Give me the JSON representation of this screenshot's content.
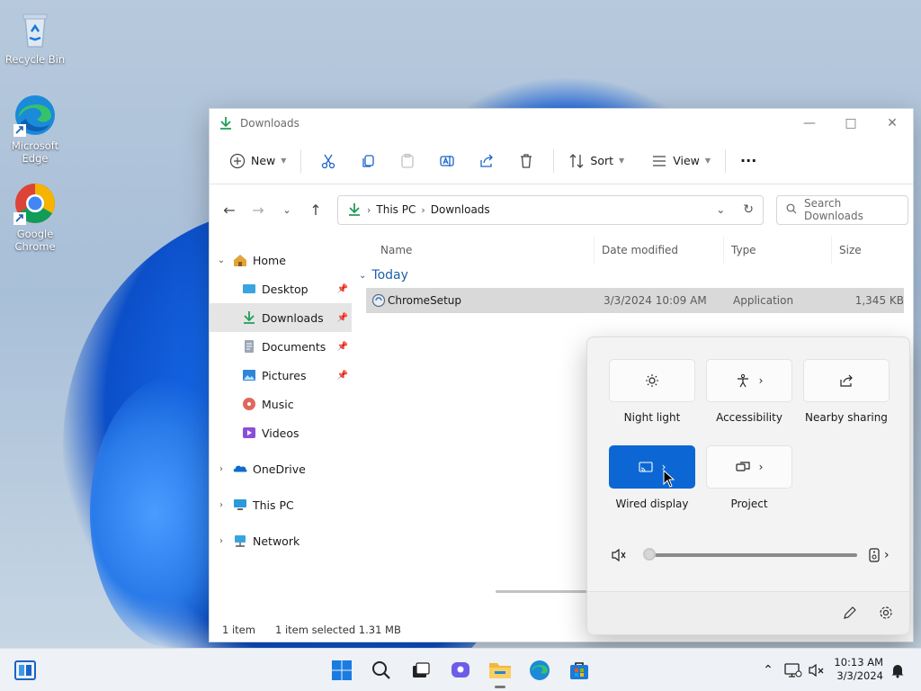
{
  "desktop": {
    "icons": [
      {
        "label": "Recycle Bin"
      },
      {
        "label": "Microsoft Edge"
      },
      {
        "label": "Google Chrome"
      }
    ]
  },
  "explorer": {
    "title": "Downloads",
    "toolbar": {
      "new_label": "New",
      "sort_label": "Sort",
      "view_label": "View",
      "more_label": "···"
    },
    "address": {
      "segments": [
        "This PC",
        "Downloads"
      ]
    },
    "search": {
      "placeholder": "Search Downloads"
    },
    "sidebar": {
      "items": [
        {
          "label": "Home"
        },
        {
          "label": "Desktop"
        },
        {
          "label": "Downloads"
        },
        {
          "label": "Documents"
        },
        {
          "label": "Pictures"
        },
        {
          "label": "Music"
        },
        {
          "label": "Videos"
        },
        {
          "label": "OneDrive"
        },
        {
          "label": "This PC"
        },
        {
          "label": "Network"
        }
      ]
    },
    "columns": [
      "Name",
      "Date modified",
      "Type",
      "Size"
    ],
    "group": "Today",
    "files": [
      {
        "name": "ChromeSetup",
        "date": "3/3/2024 10:09 AM",
        "type": "Application",
        "size": "1,345 KB"
      }
    ],
    "status": {
      "count": "1 item",
      "selection": "1 item selected  1.31 MB"
    }
  },
  "quick_settings": {
    "tiles": [
      {
        "label": "Night light",
        "active": false
      },
      {
        "label": "Accessibility",
        "active": false
      },
      {
        "label": "Nearby sharing",
        "active": false
      },
      {
        "label": "Wired display",
        "active": true
      },
      {
        "label": "Project",
        "active": false
      }
    ],
    "volume": 0,
    "accent": "#0c67d4"
  },
  "taskbar": {
    "time": "10:13 AM",
    "date": "3/3/2024"
  }
}
